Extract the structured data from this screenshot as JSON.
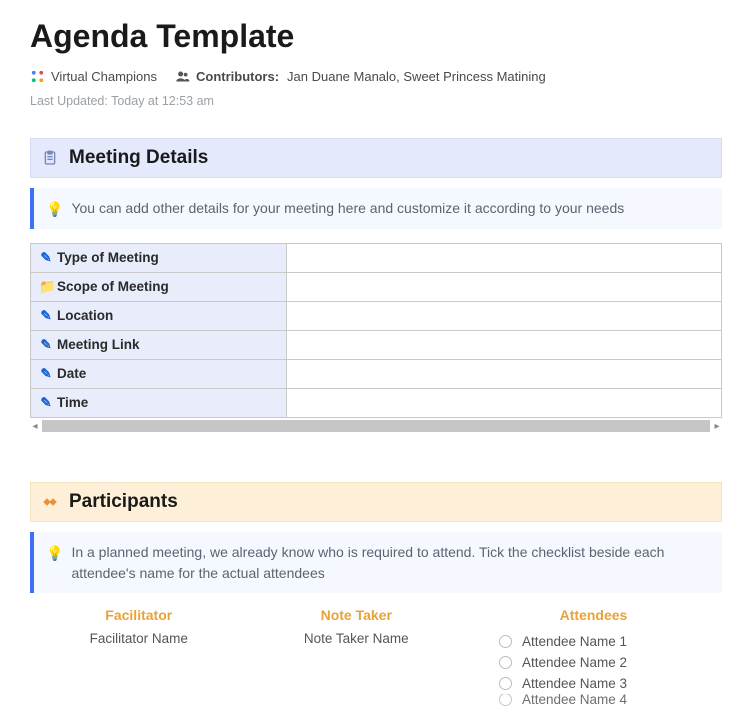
{
  "page": {
    "title": "Agenda Template",
    "workspace": "Virtual Champions",
    "contributors_label": "Contributors:",
    "contributors": "Jan Duane Manalo, Sweet Princess Matining",
    "last_updated_label": "Last Updated:",
    "last_updated_value": "Today at 12:53 am"
  },
  "meeting_details": {
    "header": "Meeting Details",
    "callout": "You can add other details for your meeting here and customize it according to your needs",
    "rows": [
      {
        "icon": "pencil",
        "label": "Type of Meeting",
        "value": ""
      },
      {
        "icon": "folder",
        "label": "Scope of Meeting",
        "value": ""
      },
      {
        "icon": "pencil",
        "label": "Location",
        "value": ""
      },
      {
        "icon": "pencil",
        "label": "Meeting Link",
        "value": ""
      },
      {
        "icon": "pencil",
        "label": "Date",
        "value": ""
      },
      {
        "icon": "pencil",
        "label": "Time",
        "value": ""
      }
    ]
  },
  "participants": {
    "header": "Participants",
    "callout": "In a planned meeting, we already know who is required to attend. Tick the checklist beside each attendee's name for the actual attendees",
    "facilitator_head": "Facilitator",
    "facilitator_value": "Facilitator Name",
    "notetaker_head": "Note Taker",
    "notetaker_value": "Note Taker Name",
    "attendees_head": "Attendees",
    "attendees": [
      "Attendee Name 1",
      "Attendee Name 2",
      "Attendee Name 3",
      "Attendee Name 4"
    ]
  }
}
